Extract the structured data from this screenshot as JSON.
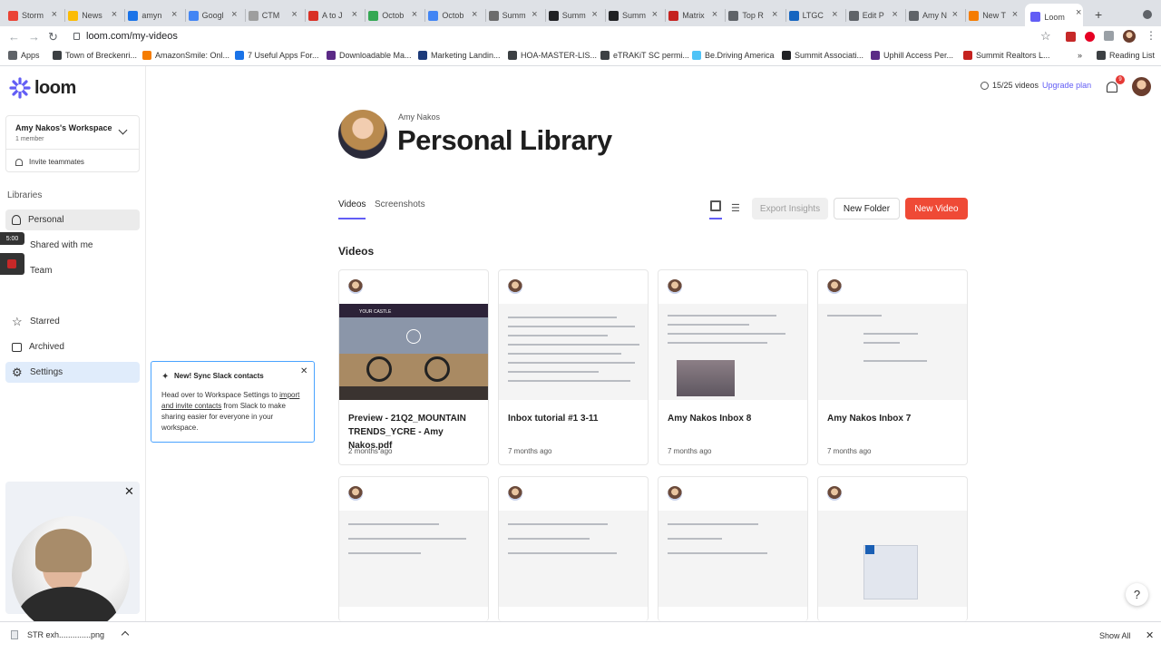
{
  "browser": {
    "tabs": [
      {
        "label": "Storm",
        "color": "#ea4335"
      },
      {
        "label": "News",
        "color": "#fbbc04"
      },
      {
        "label": "amyn",
        "color": "#1a73e8"
      },
      {
        "label": "Googl",
        "color": "#4285f4"
      },
      {
        "label": "CTM",
        "color": "#9e9e9e"
      },
      {
        "label": "A to J",
        "color": "#d93025"
      },
      {
        "label": "Octob",
        "color": "#34a853"
      },
      {
        "label": "Octob",
        "color": "#4285f4"
      },
      {
        "label": "Summ",
        "color": "#6c6c6c"
      },
      {
        "label": "Summ",
        "color": "#202124"
      },
      {
        "label": "Summ",
        "color": "#202124"
      },
      {
        "label": "Matrix",
        "color": "#c5221f"
      },
      {
        "label": "Top R",
        "color": "#5f6368"
      },
      {
        "label": "LTGC",
        "color": "#1565c0"
      },
      {
        "label": "Edit P",
        "color": "#5f6368"
      },
      {
        "label": "Amy N",
        "color": "#5f6368"
      },
      {
        "label": "New T",
        "color": "#f57c00"
      },
      {
        "label": "Loom",
        "color": "#625df5"
      }
    ],
    "url": "loom.com/my-videos",
    "bookmarks": [
      {
        "label": "Apps",
        "color": "#5f6368"
      },
      {
        "label": "Town of Breckenri...",
        "color": "#3c4043"
      },
      {
        "label": "AmazonSmile: Onl...",
        "color": "#f57c00"
      },
      {
        "label": "7 Useful Apps For...",
        "color": "#1a73e8"
      },
      {
        "label": "Downloadable Ma...",
        "color": "#5b2a86"
      },
      {
        "label": "Marketing Landin...",
        "color": "#1d3b7a"
      },
      {
        "label": "HOA-MASTER-LIS...",
        "color": "#3c4043"
      },
      {
        "label": "eTRAKiT SC permi...",
        "color": "#3c4043"
      },
      {
        "label": "Be.Driving America",
        "color": "#4fc3f7"
      },
      {
        "label": "Summit Associati...",
        "color": "#202124"
      },
      {
        "label": "Uphill Access Per...",
        "color": "#5b2a86"
      },
      {
        "label": "Summit Realtors L...",
        "color": "#c5221f"
      },
      {
        "label": "Reading List",
        "color": "#3c4043"
      }
    ]
  },
  "sidebar": {
    "brand": "loom",
    "workspace_name": "Amy Nakos's Workspace",
    "workspace_members": "1 member",
    "invite": "Invite teammates",
    "libraries_heading": "Libraries",
    "items": [
      {
        "label": "Personal",
        "icon": "person-icon"
      },
      {
        "label": "Shared with me",
        "icon": "share-icon"
      },
      {
        "label": "Team",
        "icon": "team-icon"
      },
      {
        "label": "Starred",
        "icon": "star-icon"
      },
      {
        "label": "Archived",
        "icon": "archive-icon"
      },
      {
        "label": "Settings",
        "icon": "gear-icon"
      }
    ],
    "recording_timer": "5:00"
  },
  "slack_popup": {
    "title": "New! Sync Slack contacts",
    "body_before": "Head over to Workspace Settings to ",
    "body_link": "import and invite contacts",
    "body_after": " from Slack to make sharing easier for everyone in your workspace."
  },
  "header": {
    "usage": "15/25 videos",
    "upgrade": "Upgrade plan",
    "notification_count": "9"
  },
  "library": {
    "owner": "Amy Nakos",
    "title": "Personal Library",
    "tabs": [
      "Videos",
      "Screenshots"
    ],
    "export_label": "Export Insights",
    "new_folder_label": "New Folder",
    "new_video_label": "New Video",
    "section_title": "Videos",
    "videos": [
      {
        "title": "Preview - 21Q2_MOUNTAIN TRENDS_YCRE - Amy Nakos.pdf",
        "date": "2 months ago"
      },
      {
        "title": "Inbox tutorial #1 3-11",
        "date": "7 months ago"
      },
      {
        "title": "Amy Nakos Inbox 8",
        "date": "7 months ago"
      },
      {
        "title": "Amy Nakos Inbox 7",
        "date": "7 months ago"
      }
    ]
  },
  "downloads": {
    "file": "STR exh..............png",
    "show_all": "Show All"
  },
  "help": "?",
  "thumb_text": "YOUR CASTLE"
}
